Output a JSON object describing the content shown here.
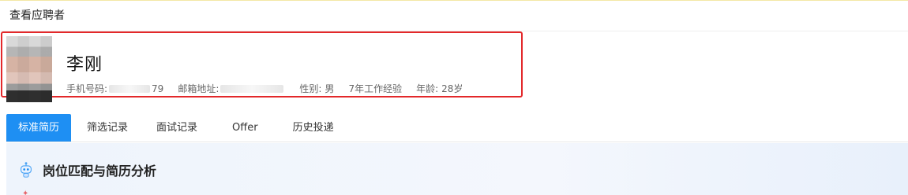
{
  "window": {
    "title": "查看应聘者"
  },
  "candidate": {
    "name": "李刚",
    "phone_label": "手机号码:",
    "phone_visible_tail": "79",
    "email_label": "邮箱地址:",
    "gender_label": "性别:",
    "gender_value": "男",
    "experience": "7年工作经验",
    "age_label": "年龄:",
    "age_value": "28岁"
  },
  "tabs": [
    {
      "label": "标准简历",
      "active": true
    },
    {
      "label": "筛选记录",
      "active": false
    },
    {
      "label": "面试记录",
      "active": false
    },
    {
      "label": "Offer",
      "active": false
    },
    {
      "label": "历史投递",
      "active": false
    }
  ],
  "analysis": {
    "title": "岗位匹配与简历分析",
    "icon": "robot-icon"
  },
  "colors": {
    "accent": "#1e8ff3",
    "highlight": "#e3282a"
  }
}
